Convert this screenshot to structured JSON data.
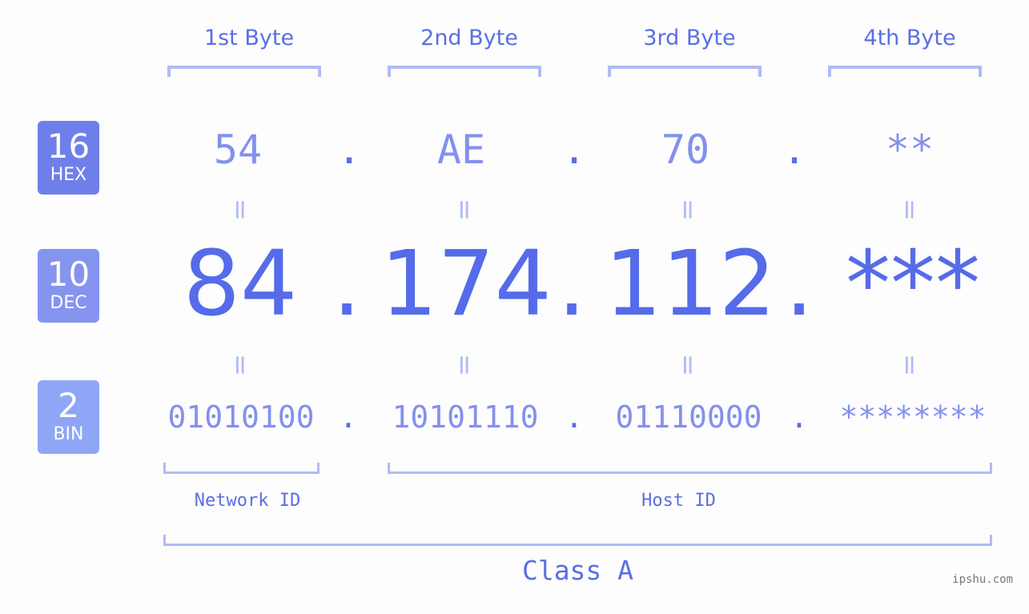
{
  "bytes": {
    "headers": [
      "1st Byte",
      "2nd Byte",
      "3rd Byte",
      "4th Byte"
    ]
  },
  "badges": {
    "hex": {
      "number": "16",
      "label": "HEX",
      "color": "#6f7fe9"
    },
    "dec": {
      "number": "10",
      "label": "DEC",
      "color": "#8594ef"
    },
    "bin": {
      "number": "2",
      "label": "BIN",
      "color": "#8fa6f7"
    }
  },
  "hex": {
    "values": [
      "54",
      "AE",
      "70",
      "**"
    ],
    "separator": "."
  },
  "dec": {
    "values": [
      "84",
      "174",
      "112",
      "***"
    ],
    "separator": "."
  },
  "bin": {
    "values": [
      "01010100",
      "10101110",
      "01110000",
      "********"
    ],
    "separator": "."
  },
  "equals_sign": "=",
  "segments": {
    "network_id": "Network ID",
    "host_id": "Host ID",
    "class": "Class A"
  },
  "watermark": "ipshu.com",
  "colors": {
    "primary": "#556bea",
    "secondary": "#8390ee",
    "bracket": "#b1bbf5"
  }
}
